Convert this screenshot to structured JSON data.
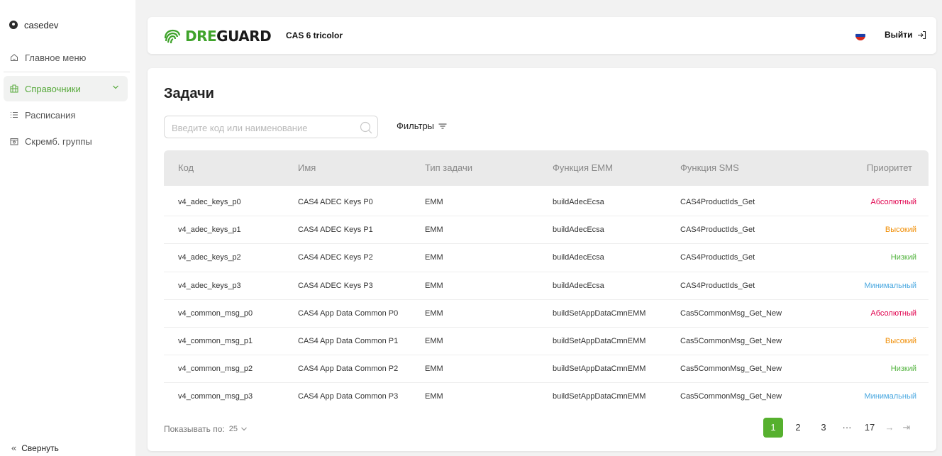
{
  "sidebar": {
    "user": "casedev",
    "items": [
      {
        "label": "Главное меню"
      },
      {
        "label": "Справочники"
      },
      {
        "label": "Расписания"
      },
      {
        "label": "Скремб. группы"
      }
    ],
    "collapse_label": "Свернуть"
  },
  "header": {
    "logo_part1": "DRE",
    "logo_part2": "GUARD",
    "product": "CAS 6 tricolor",
    "logout_label": "Выйти"
  },
  "main": {
    "title": "Задачи",
    "search": {
      "placeholder": "Введите код или наименование",
      "value": ""
    },
    "filters_label": "Фильтры",
    "columns": [
      "Код",
      "Имя",
      "Тип задачи",
      "Функция EMM",
      "Функция SMS",
      "Приоритет"
    ],
    "rows": [
      {
        "code": "v4_adec_keys_p0",
        "name": "CAS4 ADEC Keys P0",
        "type": "EMM",
        "emm": "buildAdecEcsa",
        "sms": "CAS4ProductIds_Get",
        "priority": "Абсолютный",
        "color": "#e0004d"
      },
      {
        "code": "v4_adec_keys_p1",
        "name": "CAS4 ADEC Keys P1",
        "type": "EMM",
        "emm": "buildAdecEcsa",
        "sms": "CAS4ProductIds_Get",
        "priority": "Высокий",
        "color": "#f08c00"
      },
      {
        "code": "v4_adec_keys_p2",
        "name": "CAS4 ADEC Keys P2",
        "type": "EMM",
        "emm": "buildAdecEcsa",
        "sms": "CAS4ProductIds_Get",
        "priority": "Низкий",
        "color": "#52b33e"
      },
      {
        "code": "v4_adec_keys_p3",
        "name": "CAS4 ADEC Keys P3",
        "type": "EMM",
        "emm": "buildAdecEcsa",
        "sms": "CAS4ProductIds_Get",
        "priority": "Минимальный",
        "color": "#4aa8e0"
      },
      {
        "code": "v4_common_msg_p0",
        "name": "CAS4 App Data Common P0",
        "type": "EMM",
        "emm": "buildSetAppDataCmnEMM",
        "sms": "Cas5CommonMsg_Get_New",
        "priority": "Абсолютный",
        "color": "#e0004d"
      },
      {
        "code": "v4_common_msg_p1",
        "name": "CAS4 App Data Common P1",
        "type": "EMM",
        "emm": "buildSetAppDataCmnEMM",
        "sms": "Cas5CommonMsg_Get_New",
        "priority": "Высокий",
        "color": "#f08c00"
      },
      {
        "code": "v4_common_msg_p2",
        "name": "CAS4 App Data Common P2",
        "type": "EMM",
        "emm": "buildSetAppDataCmnEMM",
        "sms": "Cas5CommonMsg_Get_New",
        "priority": "Низкий",
        "color": "#52b33e"
      },
      {
        "code": "v4_common_msg_p3",
        "name": "CAS4 App Data Common P3",
        "type": "EMM",
        "emm": "buildSetAppDataCmnEMM",
        "sms": "Cas5CommonMsg_Get_New",
        "priority": "Минимальный",
        "color": "#4aa8e0"
      }
    ],
    "page_size_label": "Показывать по:",
    "page_size_value": "25",
    "pagination": {
      "pages": [
        "1",
        "2",
        "3"
      ],
      "ellipsis": "···",
      "last": "17",
      "current": "1"
    }
  },
  "colors": {
    "accent": "#56b02e",
    "logo_green": "#3fa32b"
  }
}
